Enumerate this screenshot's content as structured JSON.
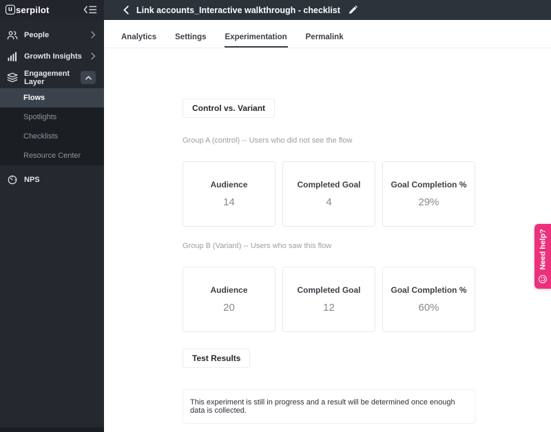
{
  "brand": {
    "logo_badge": "u",
    "logo_text": "serpilot"
  },
  "sidebar": {
    "items": [
      {
        "label": "People",
        "icon": "people-icon"
      },
      {
        "label": "Growth Insights",
        "icon": "bar-chart-icon"
      },
      {
        "label": "Engagement Layer",
        "icon": "layers-icon",
        "expanded": true
      }
    ],
    "submenu": [
      {
        "label": "Flows",
        "active": true
      },
      {
        "label": "Spotlights",
        "active": false
      },
      {
        "label": "Checklists",
        "active": false
      },
      {
        "label": "Resource Center",
        "active": false
      }
    ],
    "nps_label": "NPS"
  },
  "header": {
    "title": "Link accounts_Interactive walkthrough - checklist"
  },
  "tabs": [
    {
      "label": "Analytics",
      "active": false
    },
    {
      "label": "Settings",
      "active": false
    },
    {
      "label": "Experimentation",
      "active": true
    },
    {
      "label": "Permalink",
      "active": false
    }
  ],
  "experiment": {
    "section_title": "Control vs. Variant",
    "groups": [
      {
        "label": "Group A (control) -- Users who did not see the flow",
        "cards": [
          {
            "label": "Audience",
            "value": "14"
          },
          {
            "label": "Completed Goal",
            "value": "4"
          },
          {
            "label": "Goal Completion %",
            "value": "29%"
          }
        ]
      },
      {
        "label": "Group B (Variant) -- Users who saw this flow",
        "cards": [
          {
            "label": "Audience",
            "value": "20"
          },
          {
            "label": "Completed Goal",
            "value": "12"
          },
          {
            "label": "Goal Completion %",
            "value": "60%"
          }
        ]
      }
    ],
    "results_title": "Test Results",
    "results_message": "This experiment is still in progress and a result will be determined once enough data is collected."
  },
  "help_tab": {
    "label": "Need help?"
  },
  "colors": {
    "accent_pink": "#ee2f7b",
    "sidebar_bg": "#24292f",
    "submenu_bg": "#1b1f24",
    "active_item_bg": "#3a424b",
    "topbar_bg": "#2c333b"
  }
}
